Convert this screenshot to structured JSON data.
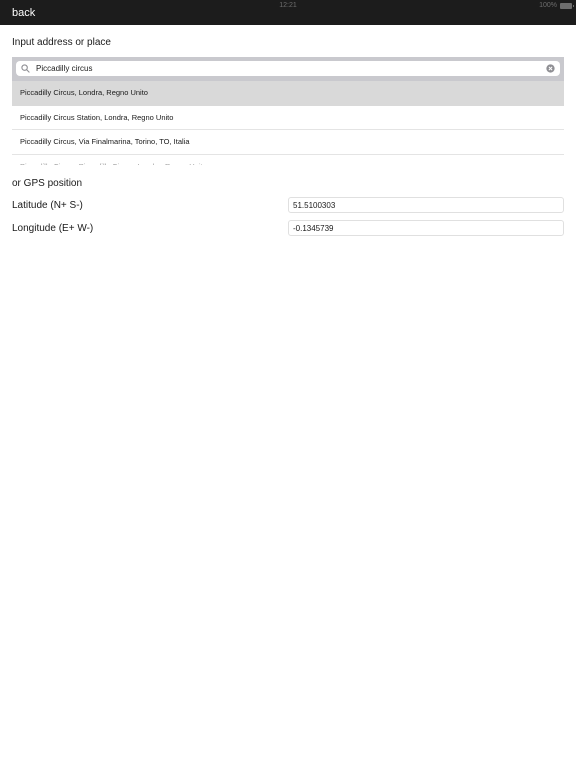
{
  "status_bar": {
    "time": "12:21",
    "battery": "100%"
  },
  "nav": {
    "back_label": "back"
  },
  "address_section": {
    "label": "Input address or place",
    "search_value": "Piccadilly circus",
    "results": [
      "Piccadilly Circus, Londra, Regno Unito",
      "Piccadilly Circus Station, Londra, Regno Unito",
      "Piccadilly Circus, Via Finalmarina, Torino, TO, Italia",
      "Piccadilly Circus, Piccadilly Circus, Londra, Regno Unito"
    ],
    "selected_index": 0
  },
  "gps_section": {
    "label": "or GPS position",
    "latitude_label": "Latitude (N+ S-)",
    "latitude_value": "51.5100303",
    "longitude_label": "Longitude (E+ W-)",
    "longitude_value": "-0.1345739"
  },
  "colors": {
    "nav_background": "#1c1c1c",
    "search_bar_background": "#c9c9ce",
    "selected_row": "#d9d9d9"
  },
  "icons": {
    "search": "search-icon",
    "clear": "clear-icon",
    "battery": "battery-icon"
  }
}
